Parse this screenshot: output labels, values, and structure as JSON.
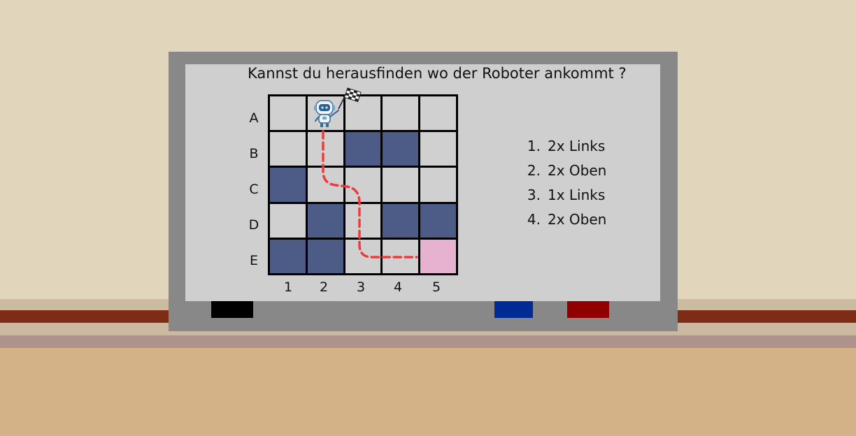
{
  "question": "Kannst du herausfinden wo der Roboter ankommt ?",
  "rows": [
    "A",
    "B",
    "C",
    "D",
    "E"
  ],
  "columns": [
    "1",
    "2",
    "3",
    "4",
    "5"
  ],
  "grid": [
    [
      "empty",
      "empty",
      "empty",
      "empty",
      "empty"
    ],
    [
      "empty",
      "empty",
      "blocked",
      "blocked",
      "empty"
    ],
    [
      "blocked",
      "empty",
      "empty",
      "empty",
      "empty"
    ],
    [
      "empty",
      "blocked",
      "empty",
      "blocked",
      "blocked"
    ],
    [
      "blocked",
      "blocked",
      "empty",
      "empty",
      "target"
    ]
  ],
  "robot": {
    "row": "A",
    "column": "2",
    "icon": "robot-with-checkered-flag-icon"
  },
  "instructions": [
    {
      "num": "1.",
      "text": "2x Links"
    },
    {
      "num": "2.",
      "text": "2x Oben"
    },
    {
      "num": "3.",
      "text": "1x Links"
    },
    {
      "num": "4.",
      "text": "2x Oben"
    }
  ],
  "markers": [
    {
      "name": "black-marker",
      "color": "#000000"
    },
    {
      "name": "blue-marker",
      "color": "#002b93"
    },
    {
      "name": "red-marker",
      "color": "#900000"
    }
  ],
  "colors": {
    "blocked": "#4d5c86",
    "target": "#e7b2cf",
    "path": "#f03a3a"
  }
}
